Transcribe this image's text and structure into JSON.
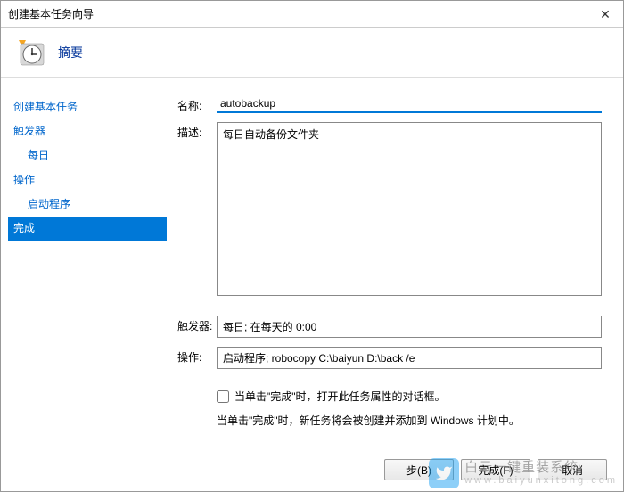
{
  "window": {
    "title": "创建基本任务向导",
    "close": "✕"
  },
  "header": {
    "title": "摘要"
  },
  "sidebar": {
    "items": [
      {
        "label": "创建基本任务",
        "indent": false,
        "selected": false
      },
      {
        "label": "触发器",
        "indent": false,
        "selected": false
      },
      {
        "label": "每日",
        "indent": true,
        "selected": false
      },
      {
        "label": "操作",
        "indent": false,
        "selected": false
      },
      {
        "label": "启动程序",
        "indent": true,
        "selected": false
      },
      {
        "label": "完成",
        "indent": false,
        "selected": true
      }
    ]
  },
  "fields": {
    "name_label": "名称:",
    "name_value": "autobackup",
    "desc_label": "描述:",
    "desc_value": "每日自动备份文件夹",
    "trigger_label": "触发器:",
    "trigger_value": "每日; 在每天的 0:00",
    "action_label": "操作:",
    "action_value": "启动程序; robocopy C:\\baiyun D:\\back /e"
  },
  "checkbox": {
    "label": "当单击\"完成\"时，打开此任务属性的对话框。"
  },
  "info": {
    "text": "当单击\"完成\"时，新任务将会被创建并添加到 Windows 计划中。"
  },
  "buttons": {
    "back": "步(B)",
    "finish": "完成(F)",
    "cancel": "取消"
  },
  "watermark": {
    "brand": "白云一键重装系统",
    "url": "www.baiyunxitong.com"
  }
}
